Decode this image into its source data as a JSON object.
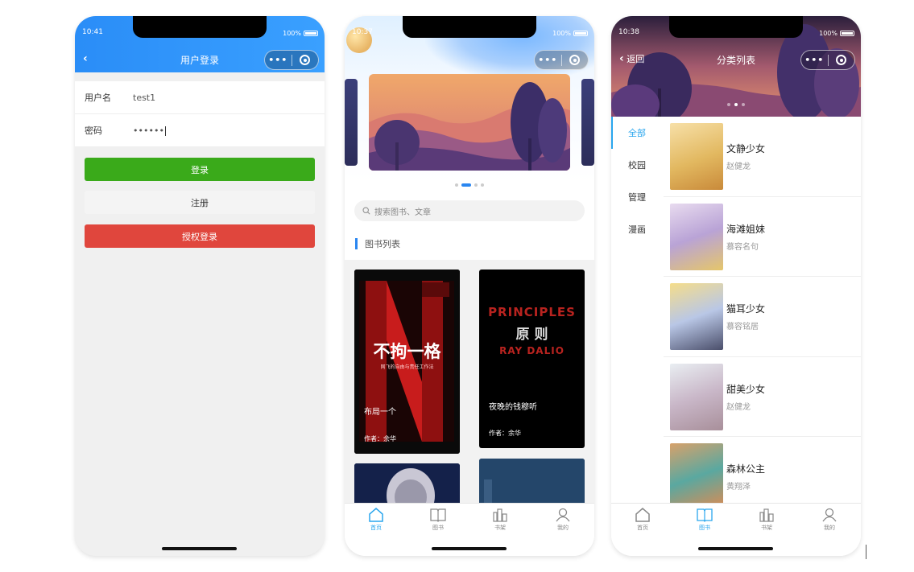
{
  "colors": {
    "primary_blue": "#2a8df7",
    "login_green": "#3aaa1a",
    "auth_red": "#e0463d",
    "tab_active": "#2aa6ee"
  },
  "login_screen": {
    "status_time": "10:41",
    "battery": "100%",
    "title": "用户登录",
    "back_icon": "chevron-left-icon",
    "username_label": "用户名",
    "username_value": "test1",
    "password_label": "密码",
    "password_value": "••••••",
    "login_button": "登录",
    "register_button": "注册",
    "auth_login_button": "授权登录"
  },
  "home_screen": {
    "status_time": "10:37",
    "battery": "100%",
    "search_placeholder": "搜索图书、文章",
    "section_title": "图书列表",
    "books": [
      {
        "title": "布局一个",
        "author": "作者：余华",
        "cover_line1": "不拘一格",
        "cover_line2": "网飞的自由与责任工作法"
      },
      {
        "title": "夜晚的钱穆听",
        "author": "作者：余华",
        "cover_line1": "PRINCIPLES",
        "cover_line2": "原 则",
        "cover_line3": "RAY DALIO"
      }
    ],
    "tabs": [
      {
        "label": "首页",
        "icon": "home-icon"
      },
      {
        "label": "图书",
        "icon": "book-icon"
      },
      {
        "label": "书架",
        "icon": "bookshelf-icon"
      },
      {
        "label": "我的",
        "icon": "user-icon"
      }
    ]
  },
  "category_screen": {
    "status_time": "10:38",
    "battery": "100%",
    "back_label": "返回",
    "title": "分类列表",
    "categories": [
      "全部",
      "校园",
      "管理",
      "漫画"
    ],
    "items": [
      {
        "name": "文静少女",
        "author": "赵健龙"
      },
      {
        "name": "海滩姐妹",
        "author": "慕容名句"
      },
      {
        "name": "猫耳少女",
        "author": "慕容铭居"
      },
      {
        "name": "甜美少女",
        "author": "赵健龙"
      },
      {
        "name": "森林公主",
        "author": "黄翔泽"
      }
    ],
    "tabs": [
      {
        "label": "首页",
        "icon": "home-icon"
      },
      {
        "label": "图书",
        "icon": "book-icon"
      },
      {
        "label": "书架",
        "icon": "bookshelf-icon"
      },
      {
        "label": "我的",
        "icon": "user-icon"
      }
    ]
  }
}
